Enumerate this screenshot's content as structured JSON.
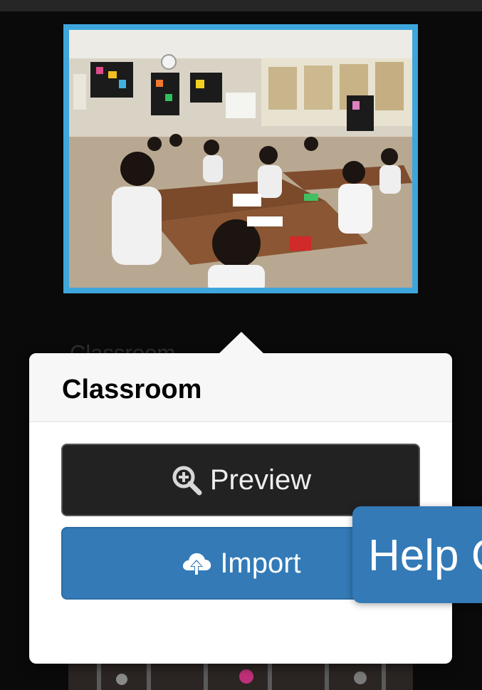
{
  "template_card": {
    "label": "Classroom"
  },
  "popover": {
    "title": "Classroom",
    "preview_label": "Preview",
    "import_label": "Import",
    "preview_icon": "zoom-in-icon",
    "import_icon": "cloud-upload-icon"
  },
  "help": {
    "label": "Help Center"
  },
  "colors": {
    "thumbnail_border": "#3ea6dc",
    "import_button": "#337ab7",
    "preview_button": "#222222",
    "help_tab": "#337ab7"
  }
}
